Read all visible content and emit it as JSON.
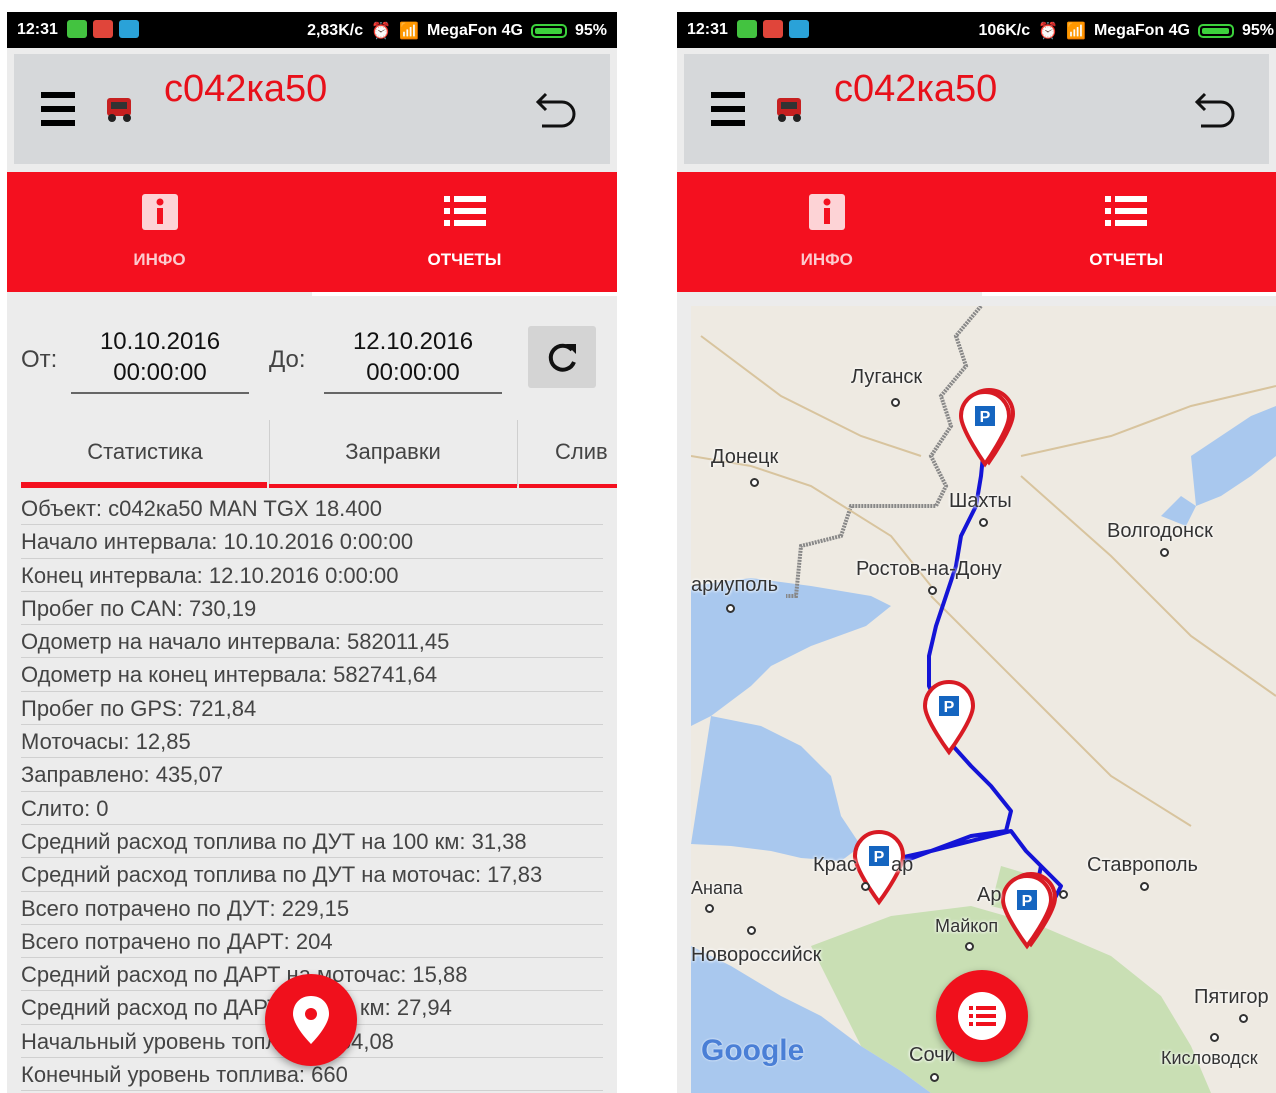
{
  "status_left": {
    "time": "12:31",
    "speed": "2,83K/c",
    "carrier": "MegaFon 4G",
    "battery": "95%"
  },
  "status_right": {
    "time": "12:31",
    "speed": "106K/c",
    "carrier": "MegaFon 4G",
    "battery": "95%"
  },
  "vehicle": {
    "plate": "с042ка50"
  },
  "tabs": [
    {
      "label": "ИНФО",
      "icon": "info-icon"
    },
    {
      "label": "ОТЧЕТЫ",
      "icon": "list-icon",
      "active": true
    }
  ],
  "filter": {
    "from_label": "От:",
    "from_date": "10.10.2016",
    "from_time": "00:00:00",
    "to_label": "До:",
    "to_date": "12.10.2016",
    "to_time": "00:00:00"
  },
  "report_tabs": [
    "Статистика",
    "Заправки",
    "Слив"
  ],
  "stats": [
    "Объект: с042ка50 MAN TGX 18.400",
    "Начало интервала: 10.10.2016 0:00:00",
    "Конец интервала: 12.10.2016 0:00:00",
    "Пробег по CAN: 730,19",
    "Одометр на начало интервала: 582011,45",
    "Одометр на конец интервала: 582741,64",
    "Пробег по GPS: 721,84",
    "Моточасы: 12,85",
    "Заправлено: 435,07",
    "Слито: 0",
    "Средний расход топлива по ДУТ на 100 км: 31,38",
    "Средний расход топлива по ДУТ на моточас: 17,83",
    "Всего потрачено по ДУТ: 229,15",
    "Всего потрачено по ДАРТ: 204",
    "Средний расход по ДАРТ на моточас: 15,88",
    "Средний расход по ДАРТ на 100 км: 27,94",
    "Начальный уровень топлива: 454,08",
    "Конечный уровень топлива: 660"
  ],
  "map": {
    "cities": [
      "Луганск",
      "Донецк",
      "Шахты",
      "Волгодонск",
      "Ростов-на-Дону",
      "ариуполь",
      "Крас",
      "ар",
      "Ставрополь",
      "Анапа",
      "Ар",
      "Майкоп",
      "Новороссийск",
      "Пятигор",
      "Кисловодск",
      "Сочи"
    ],
    "logo": "Google",
    "parking_marker_label": "P",
    "colors": {
      "route": "#1414d6",
      "marker": "#d81b24",
      "parking": "#1565c0",
      "sea": "#a9c8ee",
      "land": "#eeeae2",
      "forest": "#c9dfb4"
    }
  },
  "colors": {
    "accent": "#f4101f",
    "plate": "#e8101a",
    "toolbar": "#d6d8da"
  }
}
